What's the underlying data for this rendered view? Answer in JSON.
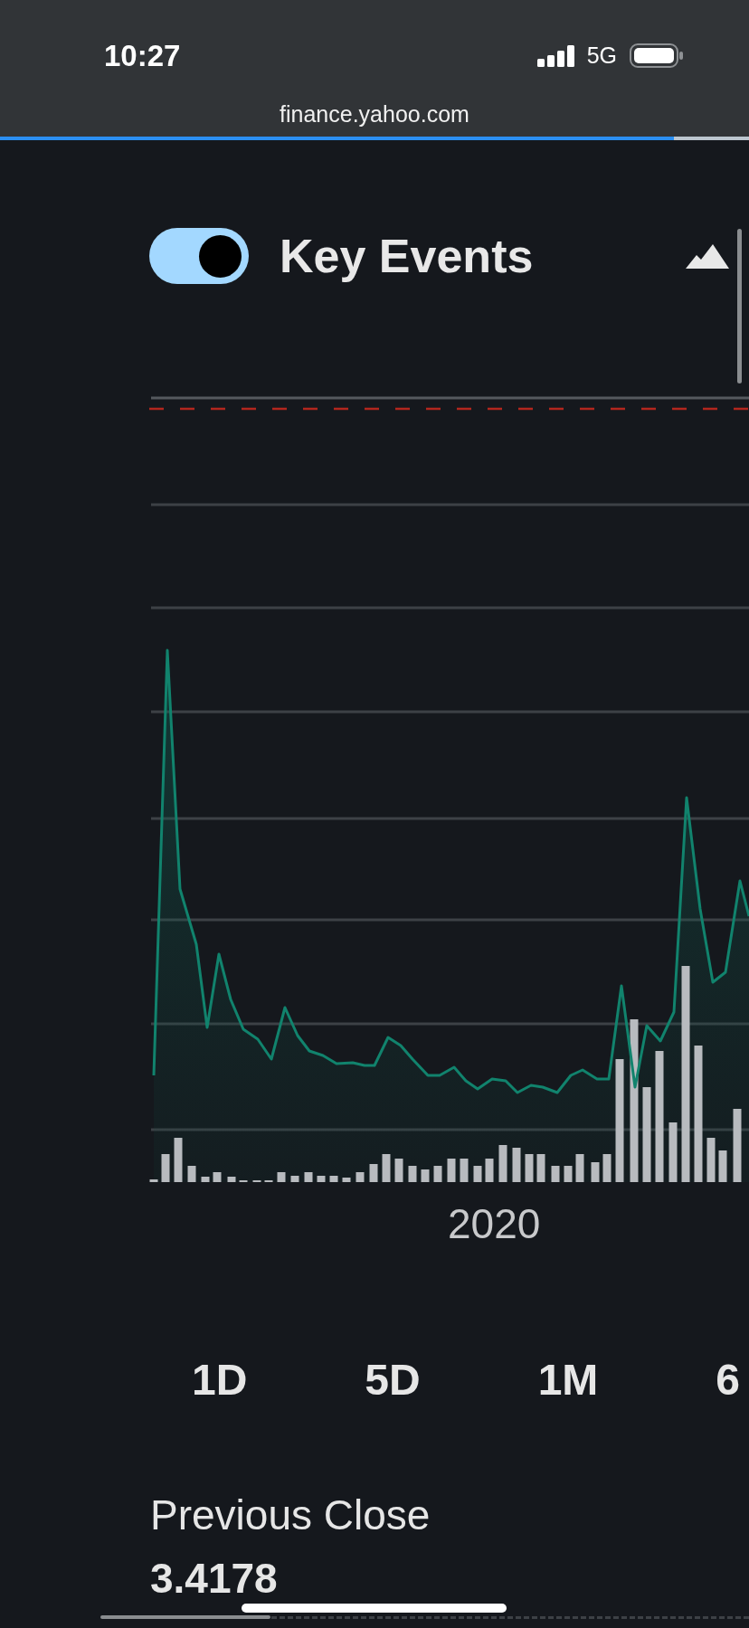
{
  "status_bar": {
    "time": "10:27",
    "network": "5G"
  },
  "address_bar": {
    "url": "finance.yahoo.com",
    "load_progress": {
      "level": 0.9
    }
  },
  "key_events": {
    "label": "Key Events",
    "on": true
  },
  "chart": {
    "axis_labels": [
      "2020"
    ]
  },
  "range_tabs": [
    {
      "label": "1D",
      "selected": false
    },
    {
      "label": "5D",
      "selected": false
    },
    {
      "label": "1M",
      "selected": false
    },
    {
      "label": "6",
      "selected": false
    }
  ],
  "stats": [
    {
      "label": "Previous Close",
      "value": "3.4178"
    }
  ]
}
